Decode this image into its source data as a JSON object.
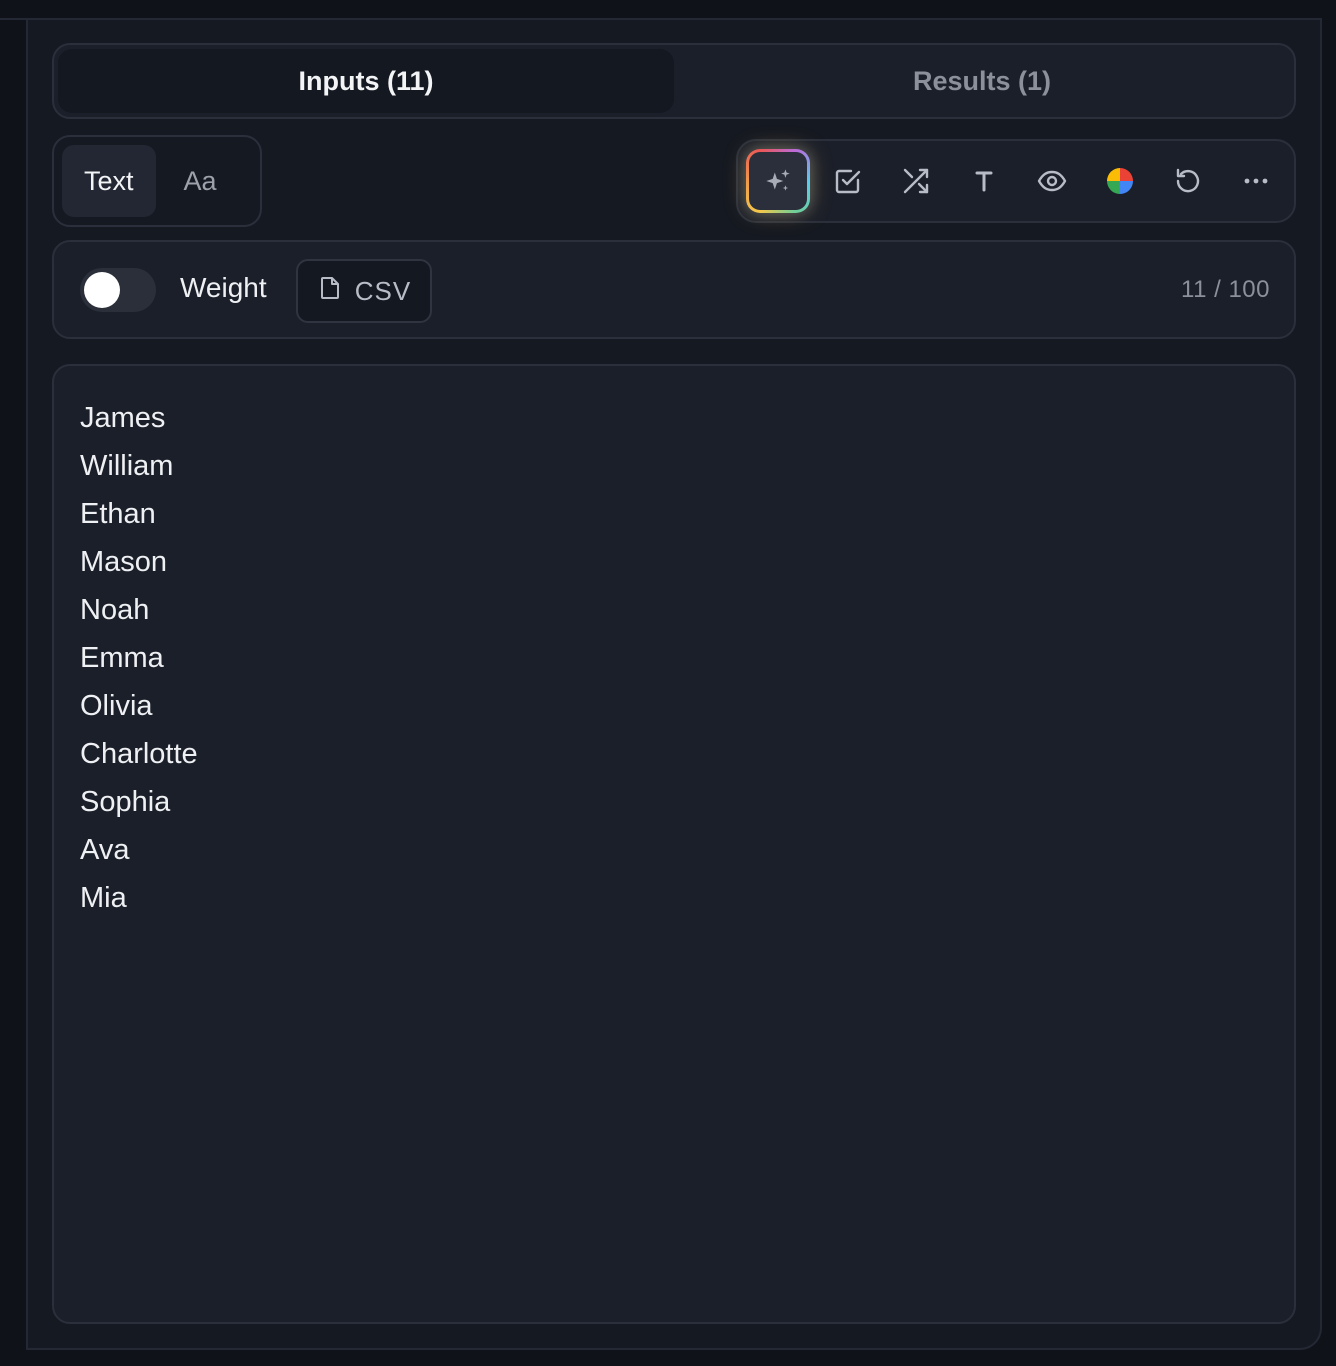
{
  "tabs": [
    {
      "label": "Inputs (11)",
      "active": true
    },
    {
      "label": "Results (1)",
      "active": false
    }
  ],
  "mode": {
    "options": [
      "Text",
      "Aa"
    ],
    "selected": "Text"
  },
  "toolbar": {
    "tools": [
      "sparkles-icon",
      "checkbox-icon",
      "shuffle-icon",
      "text-format-icon",
      "eye-icon",
      "color-wheel-icon",
      "reset-icon",
      "more-icon"
    ]
  },
  "options": {
    "toggle_on": false,
    "weight_label": "Weight",
    "csv_label": "CSV",
    "count": "11 / 100"
  },
  "entries": [
    "James",
    "William",
    "Ethan",
    "Mason",
    "Noah",
    "Emma",
    "Olivia",
    "Charlotte",
    "Sophia",
    "Ava",
    "Mia"
  ],
  "colors": {
    "background": "#151921",
    "surface": "#1b1f29",
    "border": "#2a2f3b",
    "text": "#eef0f3",
    "muted": "#8b909b"
  }
}
